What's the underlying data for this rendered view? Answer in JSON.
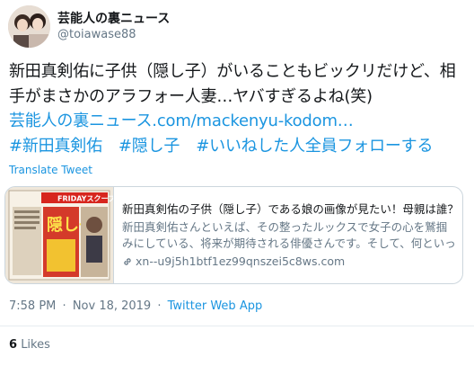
{
  "user": {
    "display_name": "芸能人の裏ニュース",
    "handle": "@toiawase88"
  },
  "tweet": {
    "line1": "新田真剣佑に子供（隠し子）がいることもビックリだけど、相",
    "line2": "手がまさかのアラフォー人妻…ヤバすぎるよね(笑)",
    "link_text": "芸能人の裏ニュース.com/mackenyu-kodom…",
    "hashtags": [
      "#新田真剣佑",
      "#隠し子",
      "#いいねした人全員フォローする"
    ],
    "translate_label": "Translate Tweet"
  },
  "card": {
    "thumbnail_label": "FRIDAYスクープ",
    "thumbnail_headline": "隠し子",
    "title": "新田真剣佑の子供（隠し子）である娘の画像が見たい！母親は誰？",
    "description": "新田真剣佑さんといえば、その整ったルックスで女子の心を鷲掴みにしている、将来が期待される俳優さんです。そして、何といっても俳優・千葉…",
    "url": "xn--u9j5h1btf1ez99qnszei5c8ws.com",
    "link_icon": "link-icon"
  },
  "meta": {
    "time": "7:58 PM",
    "date": "Nov 18, 2019",
    "source": "Twitter Web App",
    "separator": "·"
  },
  "stats": {
    "likes_count": "6",
    "likes_label": "Likes"
  },
  "colors": {
    "link": "#1b95e0",
    "text": "#14171a",
    "muted": "#657786",
    "border": "#ccd6dd"
  }
}
